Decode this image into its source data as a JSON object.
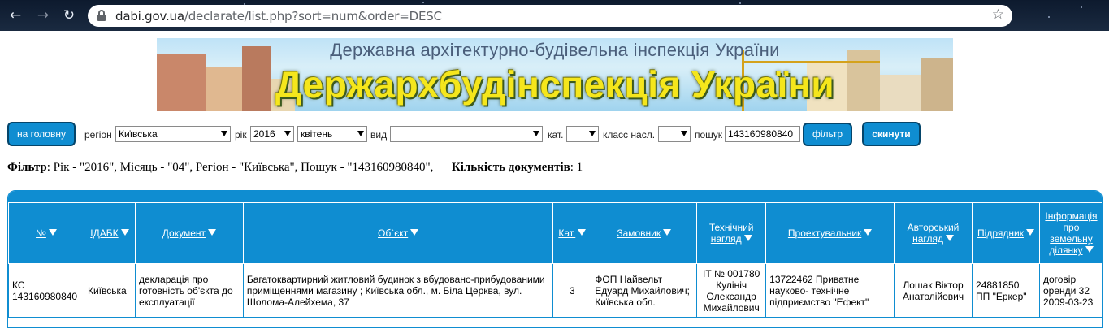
{
  "browser": {
    "url_host": "dabi.gov.ua",
    "url_path": "/declarate/list.php?sort=num&order=DESC"
  },
  "banner": {
    "subtitle": "Державна архітектурно-будівельна інспекція України",
    "title": "Держархбудінспекція України"
  },
  "filters": {
    "home_button": "на головну",
    "region_label": "регіон",
    "region_value": "Київська",
    "year_label": "рік",
    "year_value": "2016",
    "month_value": "квітень",
    "type_label": "вид",
    "type_value": "",
    "cat_label": "кат.",
    "cat_value": "",
    "class_label": "класс насл.",
    "class_value": "",
    "search_label": "пошук",
    "search_value": "143160980840",
    "filter_button": "фільтр",
    "reset_button": "скинути"
  },
  "summary": {
    "filter_label": "Фільтр",
    "filter_text": ": Рік - \"2016\", Місяць - \"04\", Регіон - \"Київська\", Пошук - \"143160980840\",",
    "count_label": "Кількість документів",
    "count_value": ": 1"
  },
  "table": {
    "headers": [
      "№",
      "ІДАБК",
      "Документ",
      "Об`єкт",
      "Кат.",
      "Замовник",
      "Технічний нагляд",
      "Проектувальник",
      "Авторський нагляд",
      "Підрядник",
      "Інформація про земельну ділянку"
    ],
    "rows": [
      {
        "num": "КС 143160980840",
        "idabk": "Київська",
        "document": "декларація про готовність об'єкта до експлуатації",
        "object": "Багатоквартирний житловий будинок з вбудовано-прибудованими приміщеннями магазину ; Київська обл., м. Біла Церква, вул. Шолома-Алейхема, 37",
        "cat": "3",
        "customer": "ФОП Найвельт Едуард Михайлович; Київська обл.",
        "tech": "ІТ № 001780 Кулініч Олександр Михайлович",
        "designer": "13722462 Приватне науково- технічне підприємство \"Ефект\"",
        "author": "Лошак Віктор Анатолійович",
        "contractor": "24881850 ПП \"Еркер\"",
        "land": "договір оренди 32 2009-03-23"
      }
    ]
  }
}
